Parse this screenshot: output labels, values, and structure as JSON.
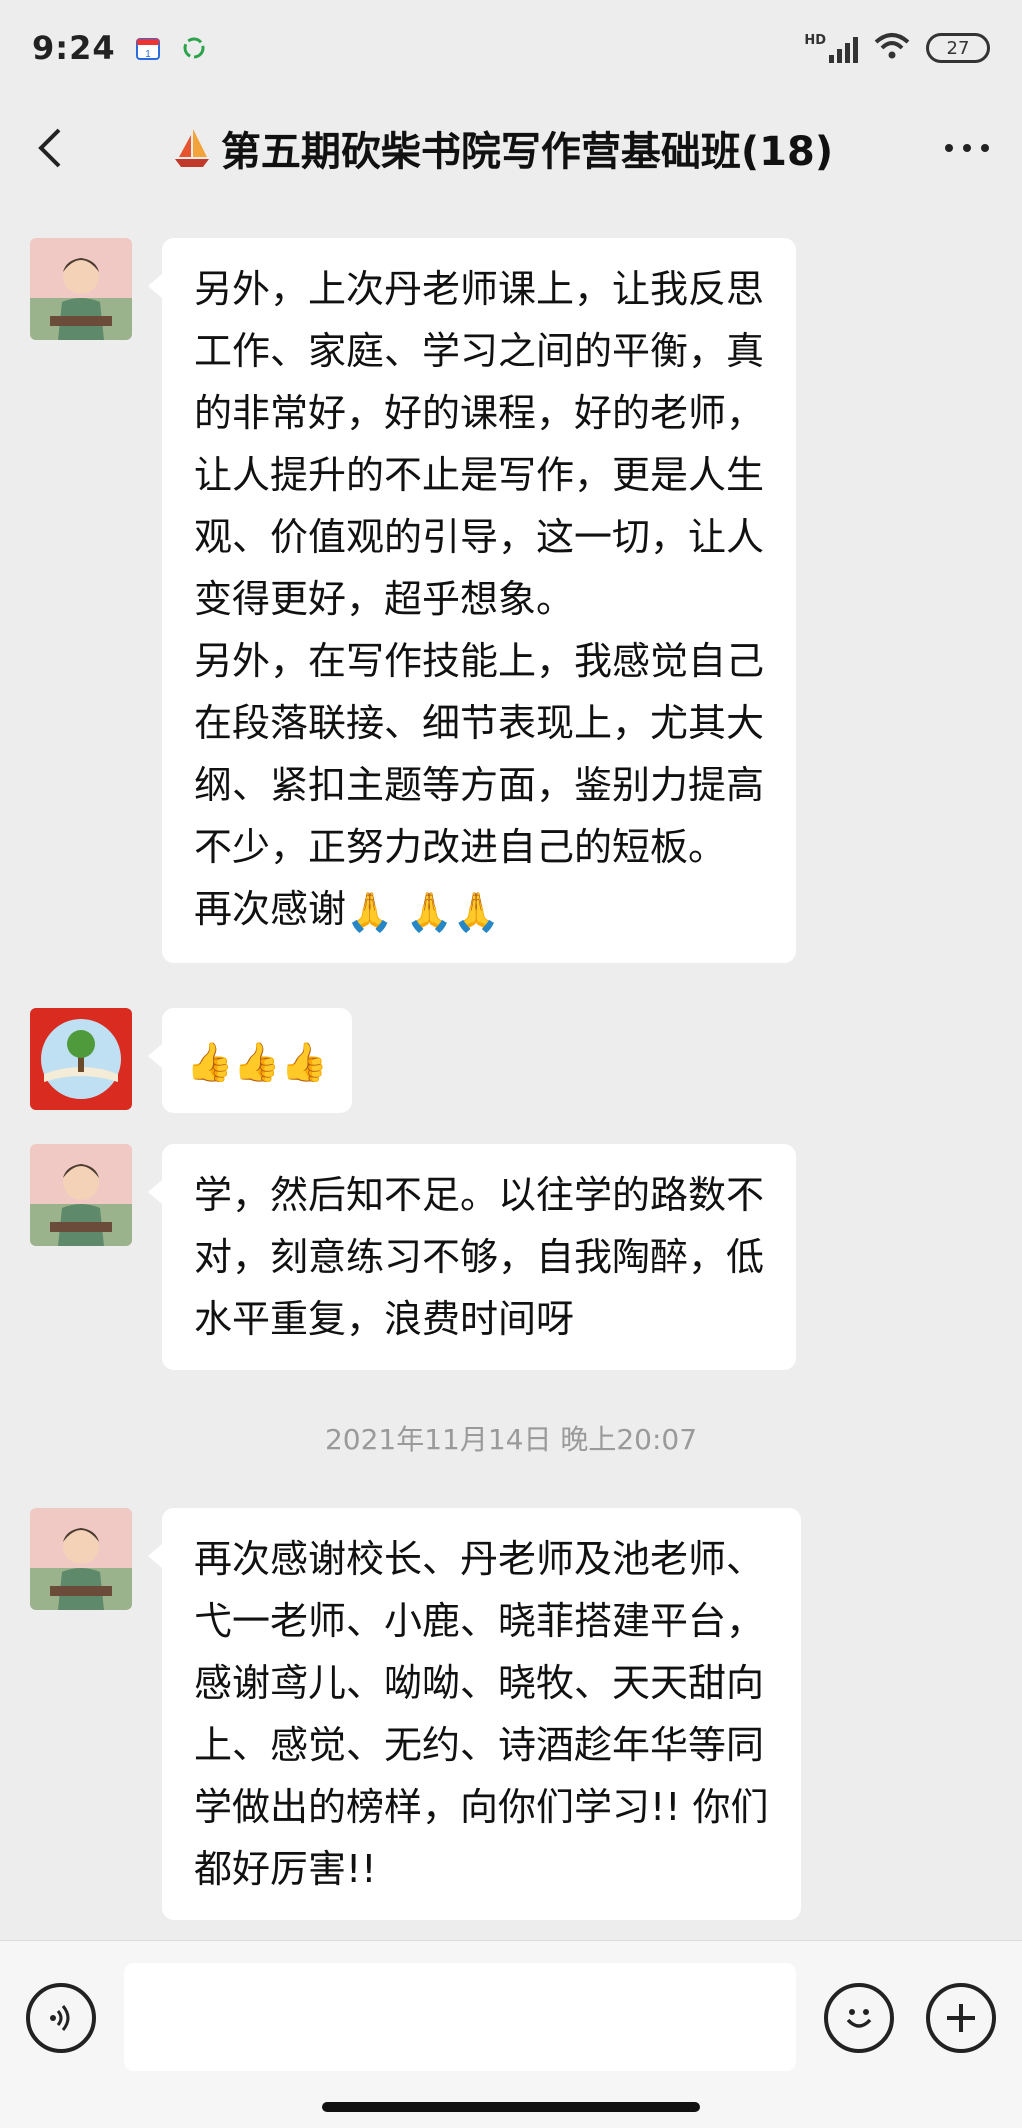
{
  "status_bar": {
    "time": "9:24",
    "app_icon_1": "calendar-app-icon",
    "app_icon_2": "recycle-app-icon",
    "network": "HD",
    "battery": "27"
  },
  "nav": {
    "title": "第五期砍柴书院写作营基础班(18)",
    "back_icon": "chevron-left-icon",
    "more_icon": "more-dots-icon"
  },
  "messages": [
    {
      "sender_avatar": "avatar-woman-green",
      "text": "另外，上次丹老师课上，让我反思\n工作、家庭、学习之间的平衡，真\n的非常好，好的课程，好的老师，\n让人提升的不止是写作，更是人生\n观、价值观的引导，这一切，让人\n变得更好，超乎想象。\n另外，在写作技能上，我感觉自己\n在段落联接、细节表现上，尤其大\n纲、紧扣主题等方面，鉴别力提高\n不少，正努力改进自己的短板。\n再次感谢",
      "emojis": [
        "🙏",
        "🙏",
        "🙏"
      ]
    },
    {
      "sender_avatar": "avatar-tree-book",
      "text": "",
      "emojis": [
        "👍",
        "👍",
        "👍"
      ]
    },
    {
      "sender_avatar": "avatar-woman-green",
      "text": "学，然后知不足。以往学的路数不\n对，刻意练习不够，自我陶醉，低\n水平重复，浪费时间呀",
      "emojis": []
    },
    {
      "sender_avatar": "avatar-woman-green",
      "text": "再次感谢校长、丹老师及池老师、\n弋一老师、小鹿、晓菲搭建平台，\n感谢鸢儿、呦呦、晓牧、天天甜向\n上、感觉、无约、诗酒趁年华等同\n学做出的榜样，向你们学习!! 你们\n都好厉害!!",
      "emojis": []
    }
  ],
  "timestamp": "2021年11月14日 晚上20:07",
  "input_bar": {
    "voice_icon": "voice-icon",
    "emoji_icon": "smiley-icon",
    "plus_icon": "plus-icon",
    "text_value": ""
  },
  "colors": {
    "background": "#ededed",
    "bubble": "#ffffff",
    "timestamp": "#9a9a9a"
  }
}
